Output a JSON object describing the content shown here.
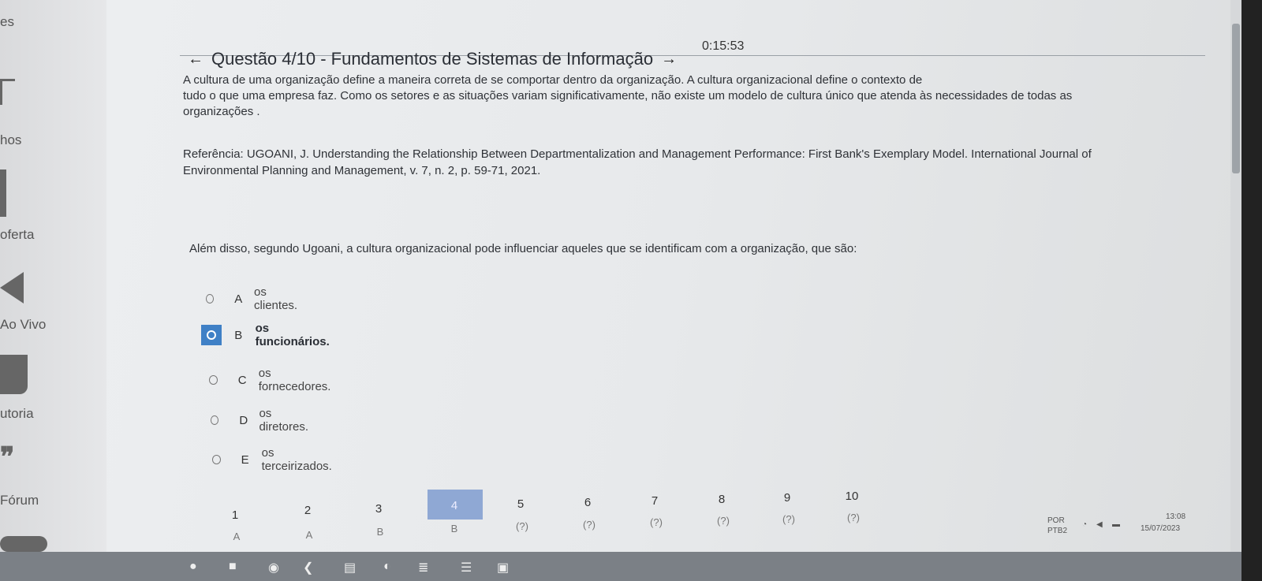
{
  "sidebar": {
    "items": [
      {
        "label": "es"
      },
      {
        "label": "hos"
      },
      {
        "label": "oferta"
      },
      {
        "label": "Ao Vivo"
      },
      {
        "label": "utoria"
      },
      {
        "label": "Fórum"
      }
    ]
  },
  "timer": "0:15:53",
  "question": {
    "title": "Questão 4/10 - Fundamentos de Sistemas de Informação",
    "paragraph_line1": "A cultura de uma organização define a maneira correta de se comportar dentro da organização. A cultura organizacional define o contexto de",
    "paragraph_line2": "tudo o que uma empresa faz. Como os setores e as situações variam significativamente, não existe um modelo de cultura único que atenda às necessidades de todas as",
    "paragraph_line3": "organizações .",
    "reference_line1": "Referência: UGOANI, J. Understanding the Relationship Between Departmentalization and Management Performance: First Bank's Exemplary Model. International Journal of",
    "reference_line2": "Environmental Planning and Management, v. 7, n. 2, p. 59-71, 2021.",
    "prompt": "Além disso, segundo Ugoani, a cultura organizacional pode influenciar aqueles que se identificam com a organização, que são:"
  },
  "options": [
    {
      "letter": "A",
      "text": "os clientes."
    },
    {
      "letter": "B",
      "text": "os funcionários."
    },
    {
      "letter": "C",
      "text": "os fornecedores."
    },
    {
      "letter": "D",
      "text": "os diretores."
    },
    {
      "letter": "E",
      "text": "os terceirizados."
    }
  ],
  "nav": {
    "numbers": [
      "1",
      "2",
      "3",
      "4",
      "5",
      "6",
      "7",
      "8",
      "9",
      "10"
    ],
    "answers": [
      "A",
      "A",
      "B",
      "B",
      "(?)",
      "(?)",
      "(?)",
      "(?)",
      "(?)",
      "(?)"
    ]
  },
  "tray": {
    "lang1": "POR",
    "lang2": "PTB2",
    "time": "13:08",
    "date": "15/07/2023"
  }
}
